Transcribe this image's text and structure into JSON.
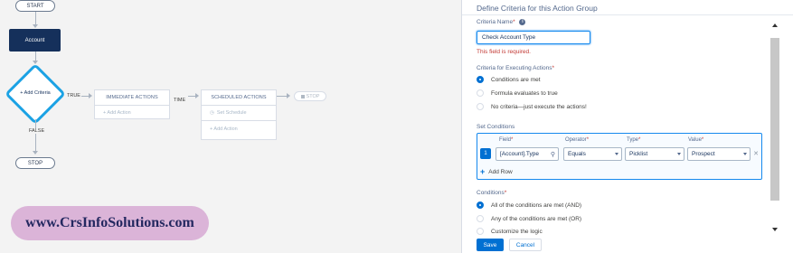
{
  "flow": {
    "start_label": "START",
    "object_node": "Account",
    "criteria_node": "+ Add Criteria",
    "true_label": "TRUE",
    "false_label": "FALSE",
    "time_label": "TIME",
    "stop_label": "STOP",
    "immediate": {
      "header": "IMMEDIATE ACTIONS",
      "add_action": "+ Add Action"
    },
    "scheduled": {
      "header": "SCHEDULED ACTIONS",
      "set_schedule": "Set Schedule",
      "add_action": "+ Add Action"
    },
    "ghost_stop": "STOP"
  },
  "watermark": "www.CrsInfoSolutions.com",
  "panel": {
    "title": "Define Criteria for this Action Group",
    "criteria_name_label": "Criteria Name",
    "criteria_name_value": "Check Account Type",
    "error": "This field is required.",
    "executing_label": "Criteria for Executing Actions",
    "executing_options": [
      "Conditions are met",
      "Formula evaluates to true",
      "No criteria—just execute the actions!"
    ],
    "set_conditions_label": "Set Conditions",
    "columns": {
      "field": "Field",
      "operator": "Operator",
      "type": "Type",
      "value": "Value"
    },
    "row": {
      "num": "1",
      "field": "[Account].Type",
      "operator": "Equals",
      "type": "Picklist",
      "value": "Prospect"
    },
    "add_row": "Add Row",
    "conditions_label": "Conditions",
    "conditions_options": [
      "All of the conditions are met (AND)",
      "Any of the conditions are met (OR)",
      "Customize the logic"
    ],
    "save": "Save",
    "cancel": "Cancel"
  },
  "colors": {
    "accent": "#0070d2",
    "node_dark": "#15305b",
    "error": "#c23934",
    "diamond_border": "#1ba2e4"
  }
}
